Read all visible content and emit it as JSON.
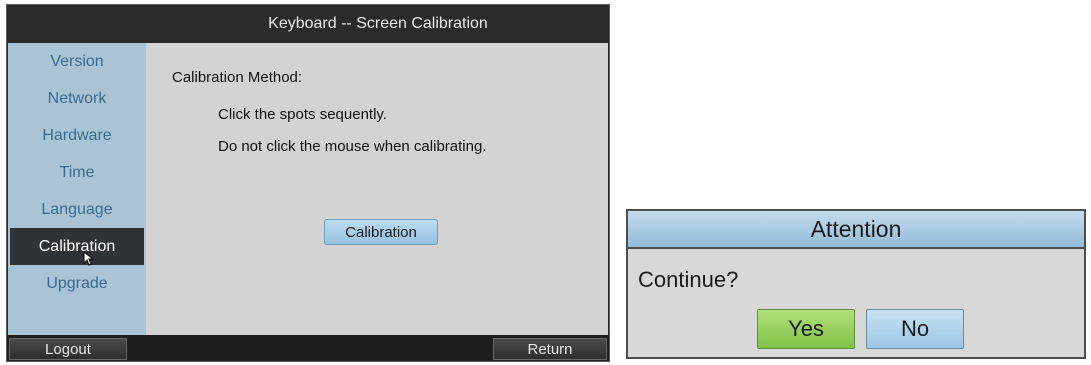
{
  "window": {
    "title": "Keyboard -- Screen Calibration"
  },
  "sidebar": {
    "items": [
      {
        "label": "Version"
      },
      {
        "label": "Network"
      },
      {
        "label": "Hardware"
      },
      {
        "label": "Time"
      },
      {
        "label": "Language"
      },
      {
        "label": "Calibration"
      },
      {
        "label": "Upgrade"
      }
    ],
    "active": "Calibration"
  },
  "main": {
    "heading": "Calibration Method:",
    "instruction1": "Click the spots sequently.",
    "instruction2": "Do not click the mouse when calibrating.",
    "calibration_button": "Calibration"
  },
  "bottom_bar": {
    "logout": "Logout",
    "return": "Return"
  },
  "dialog": {
    "title": "Attention",
    "message": "Continue?",
    "yes": "Yes",
    "no": "No"
  },
  "icons": {
    "cursor": "mouse-cursor-icon"
  },
  "colors": {
    "sidebar_bg": "#a9c4d6",
    "sidebar_text": "#3d6a8c",
    "active_item_bg": "#2e3338",
    "yes_button": "#7ec246",
    "button_blue": "#9cc7e5"
  }
}
